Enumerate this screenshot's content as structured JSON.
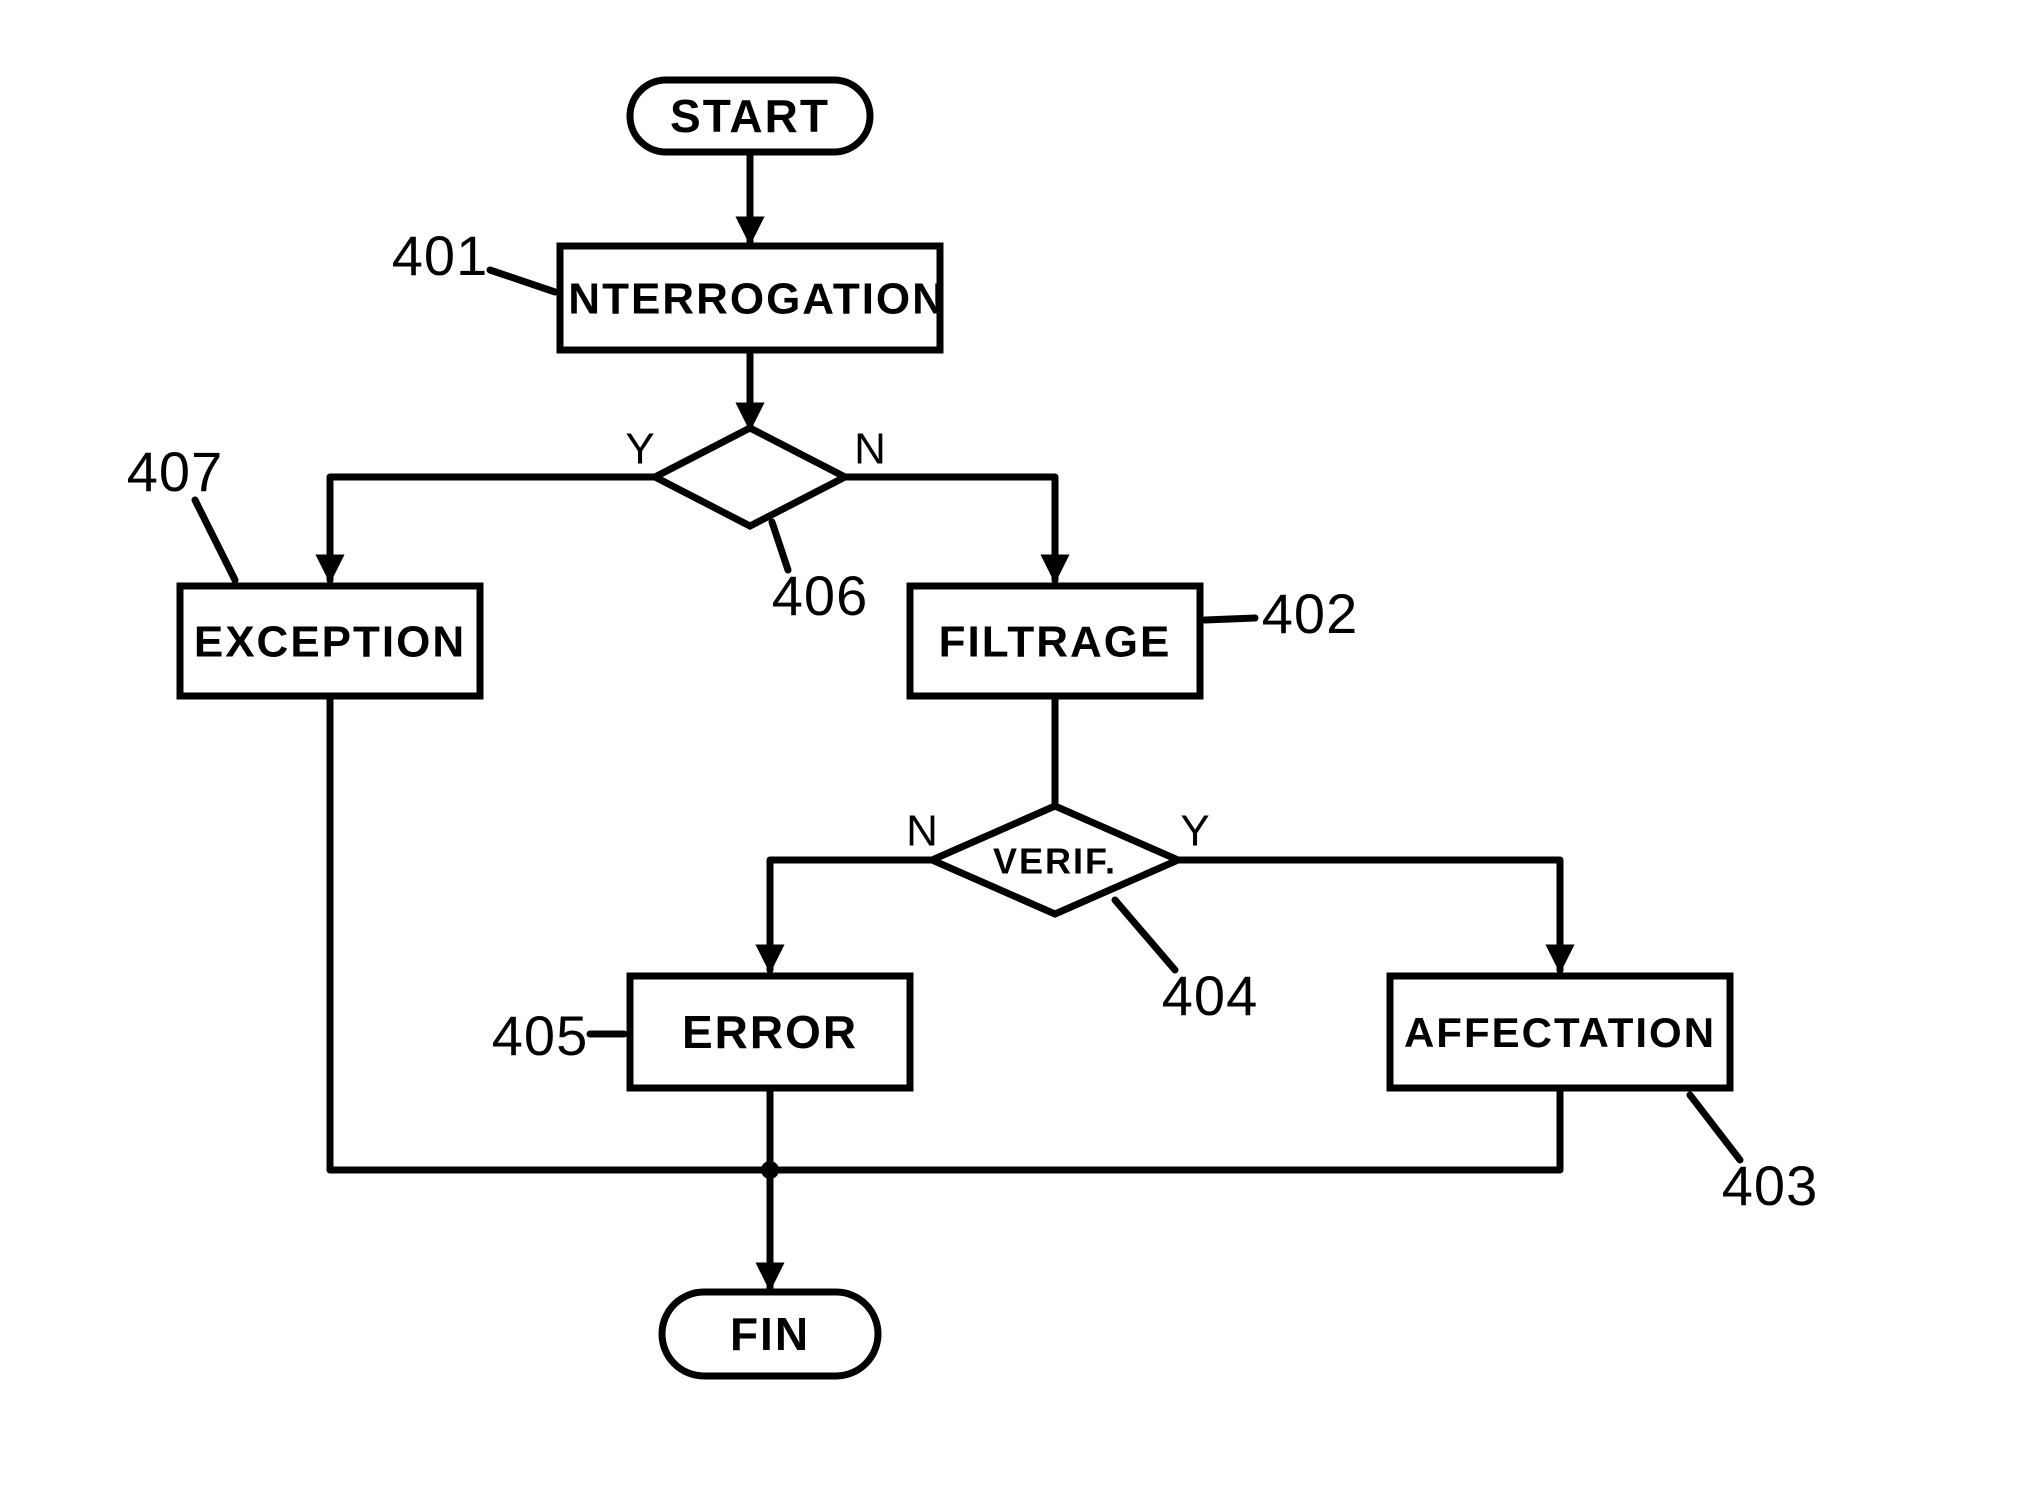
{
  "nodes": {
    "start": {
      "label": "START"
    },
    "interrogation": {
      "label": "INTERROGATION",
      "ref": "401"
    },
    "decision_ex": {
      "ref": "406",
      "yes": "Y",
      "no": "N"
    },
    "exception": {
      "label": "EXCEPTION",
      "ref": "407"
    },
    "filtrage": {
      "label": "FILTRAGE",
      "ref": "402"
    },
    "verif": {
      "label": "VERIF.",
      "ref": "404",
      "yes": "Y",
      "no": "N"
    },
    "error": {
      "label": "ERROR",
      "ref": "405"
    },
    "affectation": {
      "label": "AFFECTATION",
      "ref": "403"
    },
    "fin": {
      "label": "FIN"
    }
  }
}
